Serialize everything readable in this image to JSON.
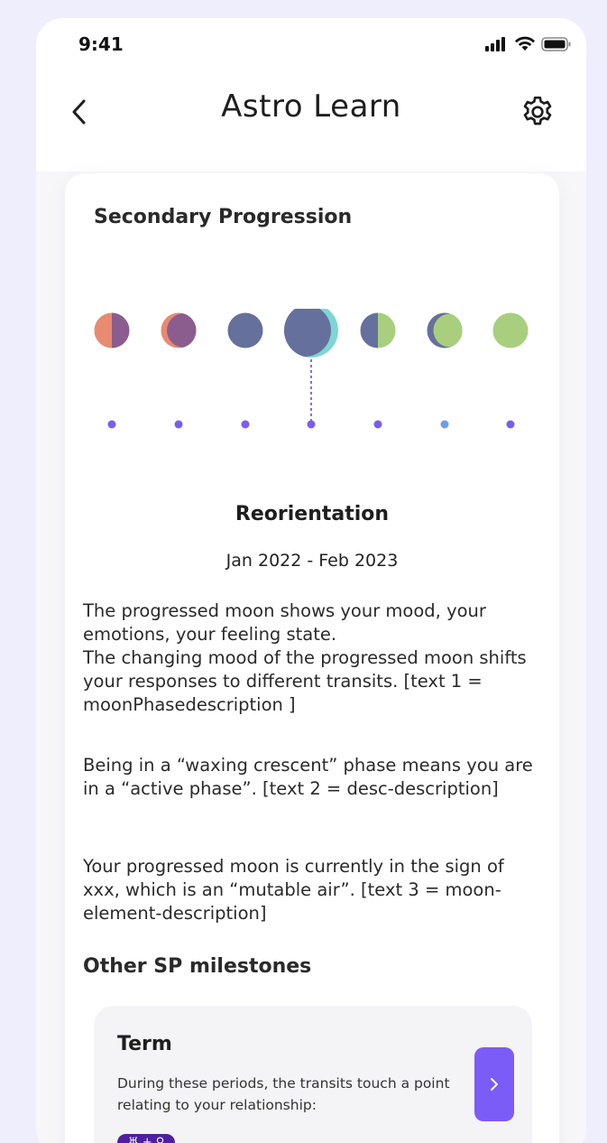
{
  "status_bar": {
    "time": "9:41"
  },
  "header": {
    "title": "Astro Learn"
  },
  "card": {
    "title": "Secondary Progression",
    "phase": {
      "name": "Reorientation",
      "dates": "Jan 2022 - Feb 2023",
      "selected_index": 3
    },
    "paragraphs": [
      "The progressed moon shows your mood, your emotions, your feeling state.\nThe changing mood of the progressed moon shifts your responses to different transits. [text 1 = moonPhasedescription ]",
      "Being in a “waxing crescent” phase means you are in a “active phase”. [text 2 = desc-description]",
      "Your progressed moon is currently in the sign of xxx, which is an “mutable air”. [text 3 = moon-element-description]"
    ]
  },
  "other_milestones": {
    "title": "Other SP milestones",
    "items": [
      {
        "title": "Term",
        "description": "During these periods, the transits touch a point relating to your relationship:",
        "badge": "♅ + ♀"
      }
    ]
  },
  "colors": {
    "accent": "#7b5cf7",
    "dot": "#7a5cf0",
    "moon_dark": "#66709c",
    "moon_orange": "#e88a70",
    "moon_purple": "#8b5d8e",
    "moon_green": "#a9cf7e",
    "moon_cyan": "#7ed6d4"
  },
  "icons": {
    "back": "chevron-left-icon",
    "settings": "gear-icon",
    "next": "chevron-right-icon"
  }
}
